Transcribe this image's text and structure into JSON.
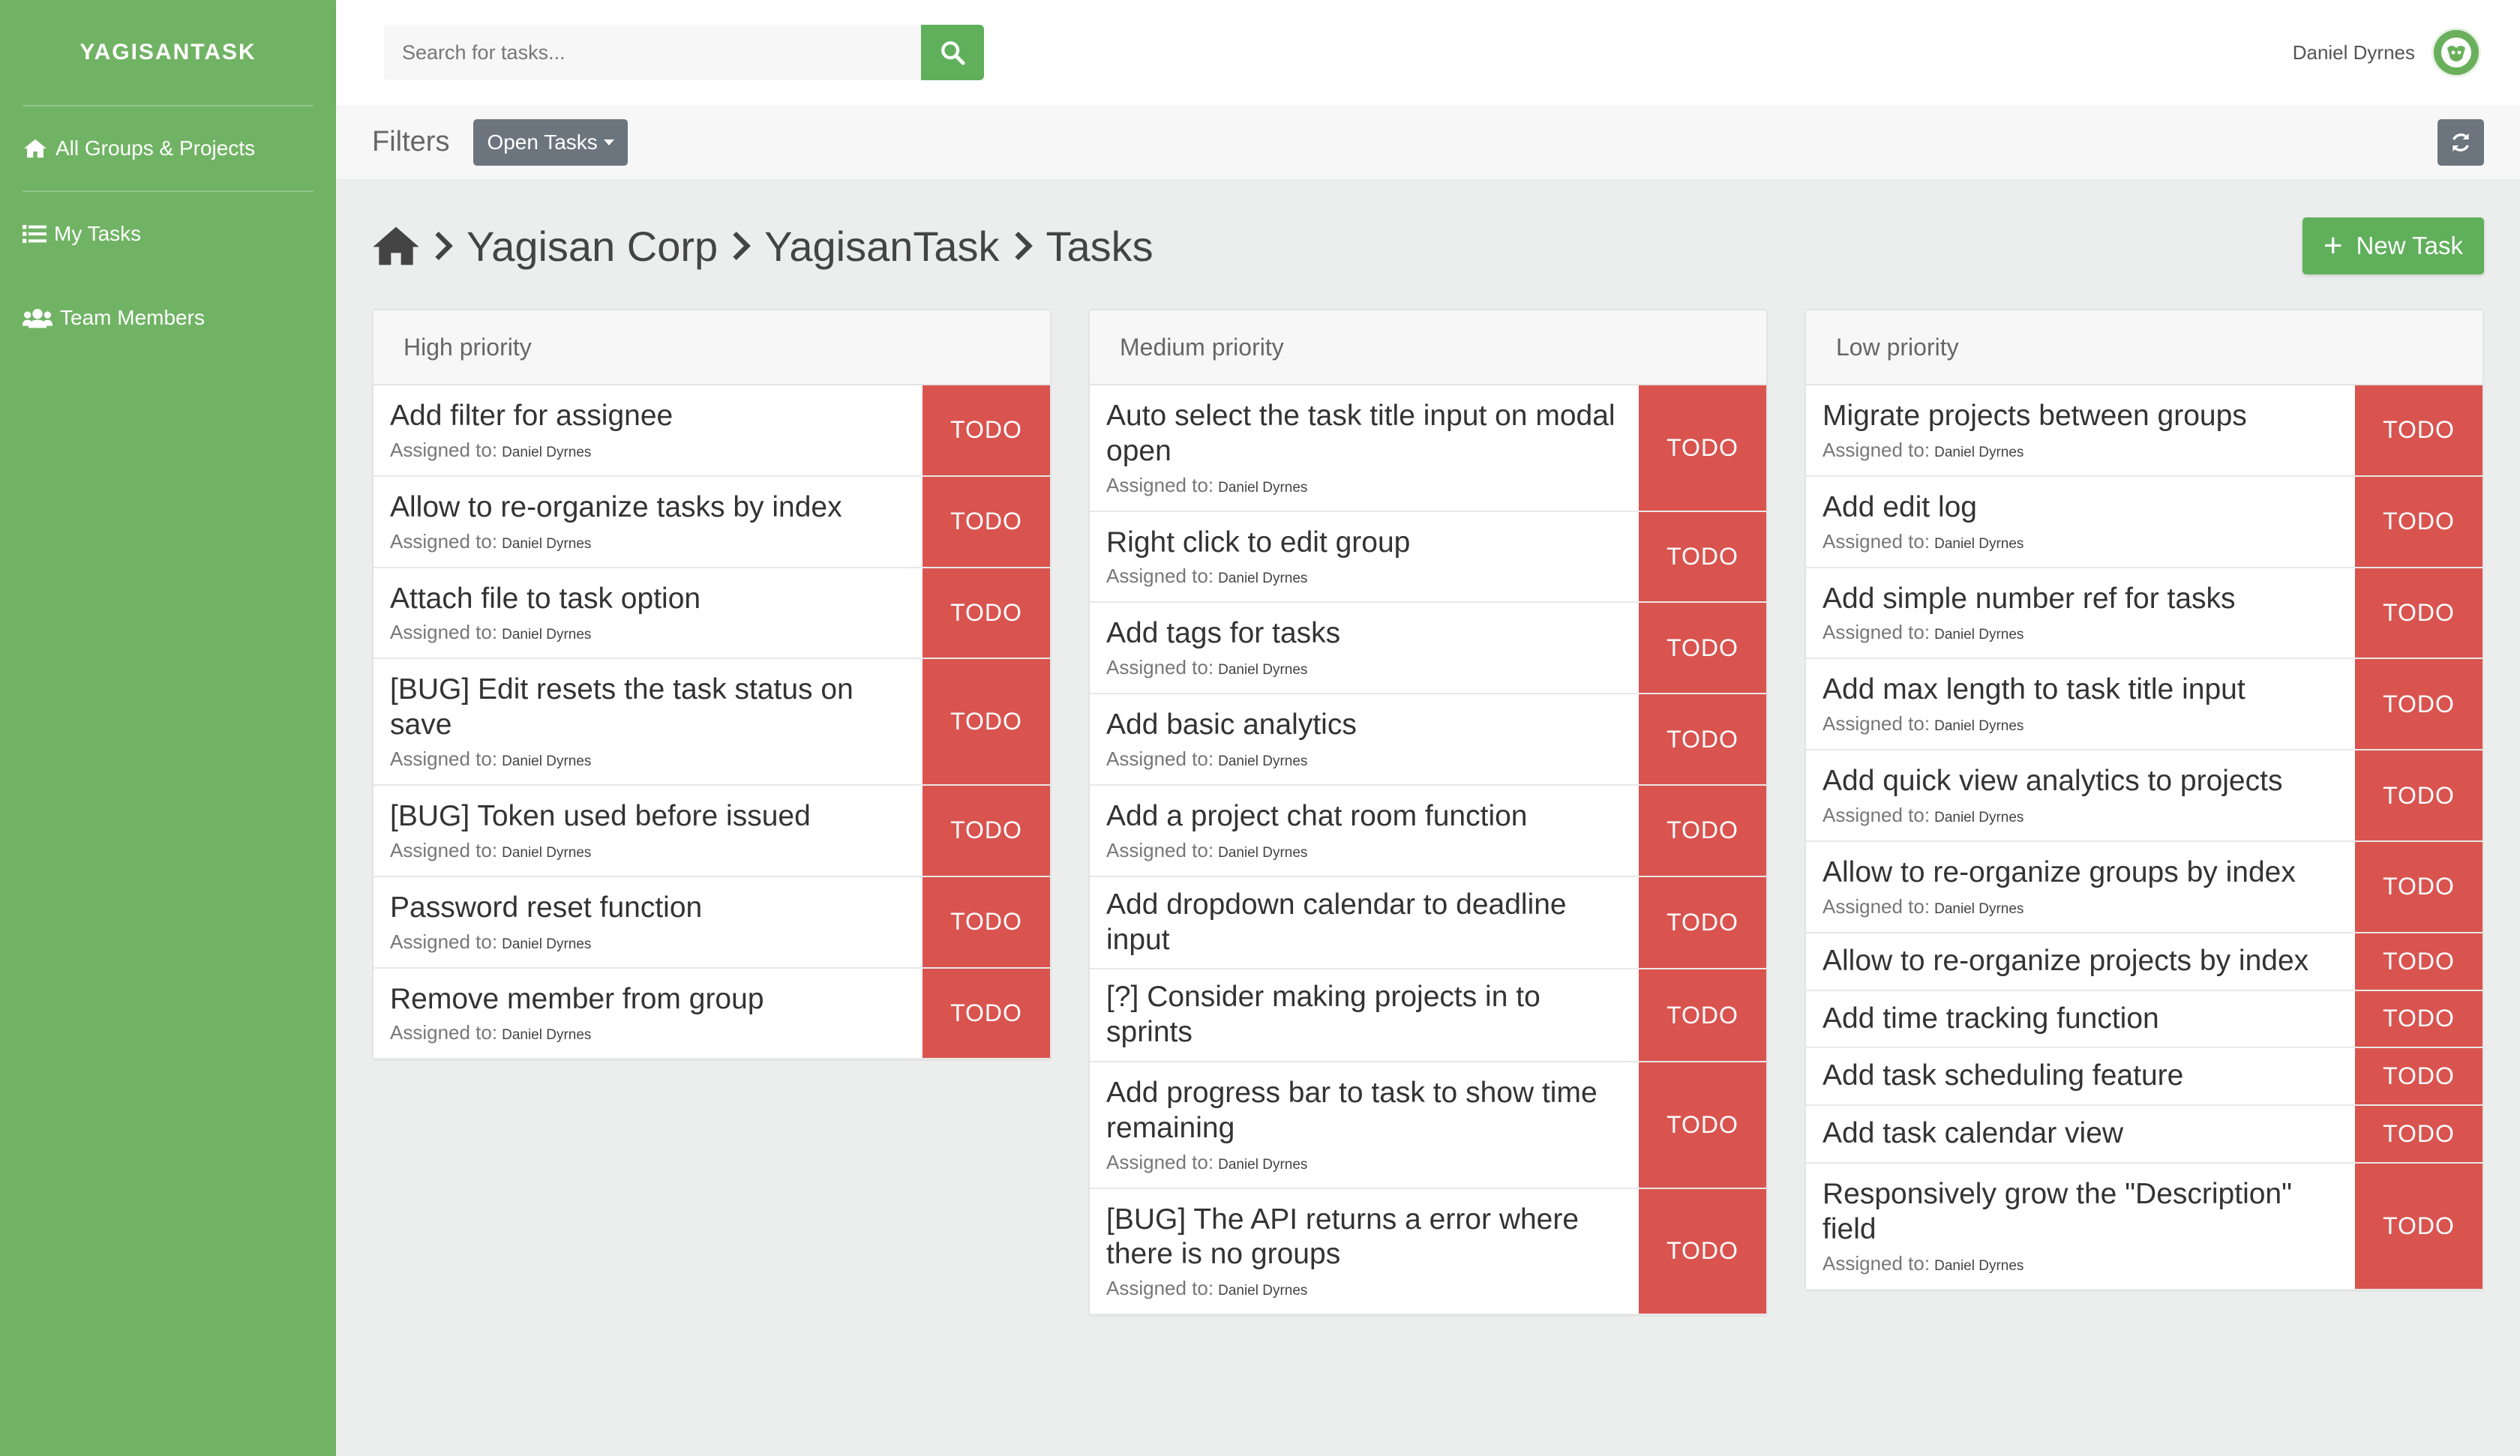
{
  "sidebar": {
    "brand": "YAGISANTASK",
    "items": [
      {
        "label": "All Groups & Projects",
        "icon": "home-icon"
      },
      {
        "label": "My Tasks",
        "icon": "list-icon"
      },
      {
        "label": "Team Members",
        "icon": "users-icon"
      }
    ]
  },
  "topbar": {
    "search_placeholder": "Search for tasks...",
    "user_name": "Daniel Dyrnes"
  },
  "filters": {
    "label": "Filters",
    "selected": "Open Tasks"
  },
  "breadcrumb": {
    "items": [
      "Yagisan Corp",
      "YagisanTask",
      "Tasks"
    ]
  },
  "new_task_label": "New Task",
  "assigned_label": "Assigned to:",
  "columns": [
    {
      "title": "High priority",
      "tasks": [
        {
          "title": "Add filter for assignee",
          "assignee": "Daniel Dyrnes",
          "status": "TODO"
        },
        {
          "title": "Allow to re-organize tasks by index",
          "assignee": "Daniel Dyrnes",
          "status": "TODO"
        },
        {
          "title": "Attach file to task option",
          "assignee": "Daniel Dyrnes",
          "status": "TODO"
        },
        {
          "title": "[BUG] Edit resets the task status on save",
          "assignee": "Daniel Dyrnes",
          "status": "TODO"
        },
        {
          "title": "[BUG] Token used before issued",
          "assignee": "Daniel Dyrnes",
          "status": "TODO"
        },
        {
          "title": "Password reset function",
          "assignee": "Daniel Dyrnes",
          "status": "TODO"
        },
        {
          "title": "Remove member from group",
          "assignee": "Daniel Dyrnes",
          "status": "TODO"
        }
      ]
    },
    {
      "title": "Medium priority",
      "tasks": [
        {
          "title": "Auto select the task title input on modal open",
          "assignee": "Daniel Dyrnes",
          "status": "TODO"
        },
        {
          "title": "Right click to edit group",
          "assignee": "Daniel Dyrnes",
          "status": "TODO"
        },
        {
          "title": "Add tags for tasks",
          "assignee": "Daniel Dyrnes",
          "status": "TODO"
        },
        {
          "title": "Add basic analytics",
          "assignee": "Daniel Dyrnes",
          "status": "TODO"
        },
        {
          "title": "Add a project chat room function",
          "assignee": "Daniel Dyrnes",
          "status": "TODO"
        },
        {
          "title": "Add dropdown calendar to deadline input",
          "assignee": "",
          "status": "TODO"
        },
        {
          "title": "[?] Consider making projects in to sprints",
          "assignee": "",
          "status": "TODO"
        },
        {
          "title": "Add progress bar to task to show time remaining",
          "assignee": "Daniel Dyrnes",
          "status": "TODO"
        },
        {
          "title": "[BUG] The API returns a error where there is no groups",
          "assignee": "Daniel Dyrnes",
          "status": "TODO"
        }
      ]
    },
    {
      "title": "Low priority",
      "tasks": [
        {
          "title": "Migrate projects between groups",
          "assignee": "Daniel Dyrnes",
          "status": "TODO"
        },
        {
          "title": "Add edit log",
          "assignee": "Daniel Dyrnes",
          "status": "TODO"
        },
        {
          "title": "Add simple number ref for tasks",
          "assignee": "Daniel Dyrnes",
          "status": "TODO"
        },
        {
          "title": "Add max length to task title input",
          "assignee": "Daniel Dyrnes",
          "status": "TODO"
        },
        {
          "title": "Add quick view analytics to projects",
          "assignee": "Daniel Dyrnes",
          "status": "TODO"
        },
        {
          "title": "Allow to re-organize groups by index",
          "assignee": "Daniel Dyrnes",
          "status": "TODO"
        },
        {
          "title": "Allow to re-organize projects by index",
          "assignee": "",
          "status": "TODO"
        },
        {
          "title": "Add time tracking function",
          "assignee": "",
          "status": "TODO"
        },
        {
          "title": "Add task scheduling feature",
          "assignee": "",
          "status": "TODO"
        },
        {
          "title": "Add task calendar view",
          "assignee": "",
          "status": "TODO"
        },
        {
          "title": "Responsively grow the \"Description\" field",
          "assignee": "Daniel Dyrnes",
          "status": "TODO"
        }
      ]
    }
  ]
}
